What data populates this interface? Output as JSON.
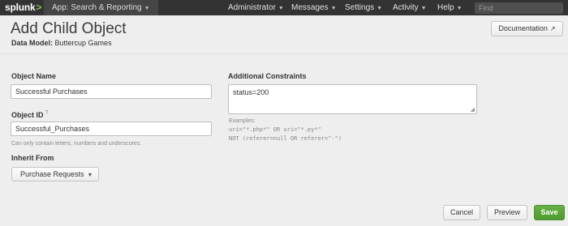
{
  "topbar": {
    "logo": "splunk",
    "logo_chevron": ">",
    "app_menu": "App: Search & Reporting",
    "nav": [
      {
        "label": "Administrator"
      },
      {
        "label": "Messages"
      },
      {
        "label": "Settings"
      },
      {
        "label": "Activity"
      },
      {
        "label": "Help"
      }
    ],
    "find_placeholder": "Find"
  },
  "header": {
    "title": "Add Child Object",
    "data_model_label": "Data Model:",
    "data_model_value": "Buttercup Games",
    "documentation_button": "Documentation",
    "external_icon": "external-link-icon"
  },
  "form": {
    "object_name": {
      "label": "Object Name",
      "value": "Successful Purchases"
    },
    "object_id": {
      "label": "Object ID",
      "help_mark": "?",
      "value": "Successful_Purchases",
      "hint": "Can only contain letters, numbers and underscores."
    },
    "inherit_from": {
      "label": "Inherit From",
      "value": "Purchase Requests"
    },
    "constraints": {
      "label": "Additional Constraints",
      "value": "status=200",
      "examples_label": "Examples:",
      "example_1": "uri=\"*.php*\" OR uri=\"*.py*\"",
      "example_2": "NOT (referer=null OR referer=\"-\")"
    }
  },
  "footer": {
    "cancel": "Cancel",
    "preview": "Preview",
    "save": "Save"
  },
  "colors": {
    "topbar": "#333333",
    "app_menu_bg": "#454545",
    "background": "#eeeeee",
    "save_green": "#5aa53a",
    "logo_chevron": "#8bc34a"
  }
}
